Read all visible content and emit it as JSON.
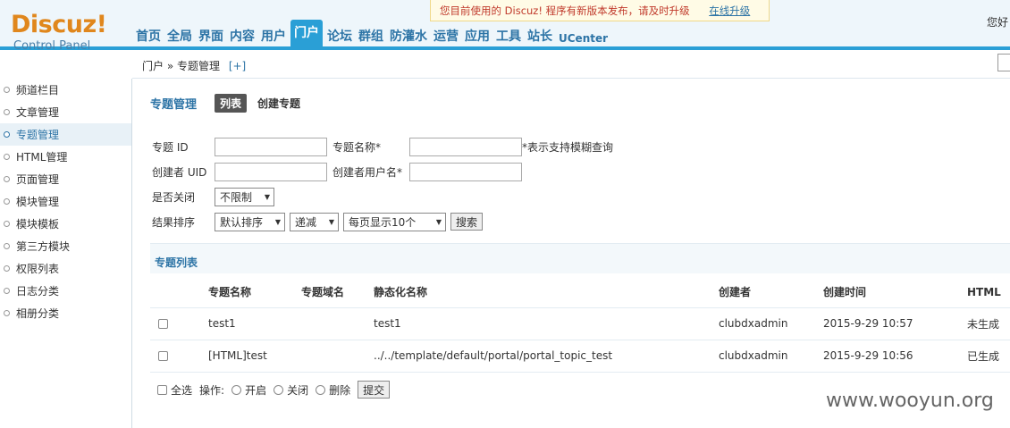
{
  "header": {
    "logo_main": "Discuz!",
    "logo_sub": "Control Panel",
    "nav": [
      "首页",
      "全局",
      "界面",
      "内容",
      "用户",
      "门户",
      "论坛",
      "群组",
      "防灌水",
      "运营",
      "应用",
      "工具",
      "站长",
      "UCenter"
    ],
    "active_nav": "门户",
    "notice_text": "您目前使用的 Discuz! 程序有新版本发布，请及时升级",
    "notice_link": "在线升级",
    "greeting": "您好"
  },
  "breadcrumb": {
    "text": "门户 » 专题管理",
    "plus": "[+]"
  },
  "sidebar": {
    "items": [
      "频道栏目",
      "文章管理",
      "专题管理",
      "HTML管理",
      "页面管理",
      "模块管理",
      "模块模板",
      "第三方模块",
      "权限列表",
      "日志分类",
      "相册分类"
    ],
    "active": "专题管理"
  },
  "main": {
    "title": "专题管理",
    "tab_list": "列表",
    "tab_create": "创建专题"
  },
  "form": {
    "topic_id_label": "专题 ID",
    "topic_name_label": "专题名称*",
    "fuzzy_hint": "*表示支持模糊查询",
    "creator_uid_label": "创建者 UID",
    "creator_name_label": "创建者用户名*",
    "closed_label": "是否关闭",
    "closed_value": "不限制",
    "sort_label": "结果排序",
    "sort_value": "默认排序",
    "order_value": "递减",
    "perpage_value": "每页显示10个",
    "search_button": "搜索"
  },
  "list": {
    "section_title": "专题列表",
    "columns": [
      "专题名称",
      "专题域名",
      "静态化名称",
      "创建者",
      "创建时间",
      "HTML"
    ],
    "rows": [
      {
        "name": "test1",
        "domain": "",
        "static_name": "test1",
        "creator": "clubdxadmin",
        "time": "2015-9-29 10:57",
        "html": "未生成",
        "html_color": "#cc0000"
      },
      {
        "name": "[HTML]test",
        "domain": "",
        "static_name": "../../template/default/portal/portal_topic_test",
        "creator": "clubdxadmin",
        "time": "2015-9-29 10:56",
        "html": "已生成",
        "html_color": "#0000cc"
      }
    ]
  },
  "ops": {
    "select_all": "全选",
    "op_label": "操作:",
    "open": "开启",
    "close": "关闭",
    "delete": "删除",
    "submit": "提交"
  },
  "watermark": "www.wooyun.org"
}
